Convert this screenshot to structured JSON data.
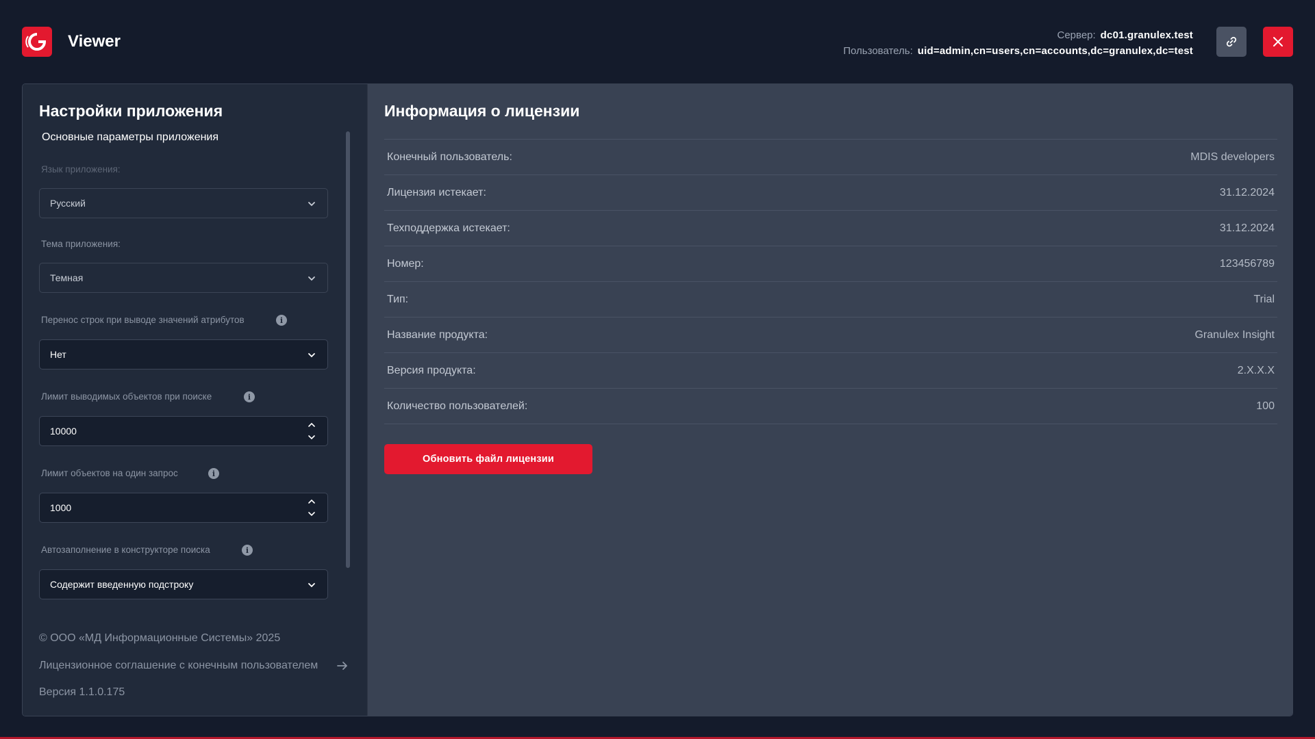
{
  "header": {
    "app_title": "Viewer",
    "server_label": "Сервер:",
    "server_value": "dc01.granulex.test",
    "user_label": "Пользователь:",
    "user_value": "uid=admin,cn=users,cn=accounts,dc=granulex,dc=test",
    "link_icon": "link-icon",
    "close_icon": "close-icon"
  },
  "settings": {
    "title": "Настройки приложения",
    "section": "Основные параметры приложения",
    "language_label": "Язык приложения:",
    "language_value": "Русский",
    "theme_label": "Тема приложения:",
    "theme_value": "Темная",
    "wrap_label": "Перенос строк при выводе значений атрибутов",
    "wrap_value": "Нет",
    "search_limit_label": "Лимит выводимых объектов при поиске",
    "search_limit_value": "10000",
    "request_limit_label": "Лимит объектов на один запрос",
    "request_limit_value": "1000",
    "autocomplete_label": "Автозаполнение в конструкторе поиска",
    "autocomplete_value": "Содержит введенную подстроку"
  },
  "footer": {
    "copyright": "© ООО «МД Информационные Системы» 2025",
    "eula_link": "Лицензионное соглашение с конечным пользователем",
    "version": "Версия 1.1.0.175"
  },
  "license": {
    "title": "Информация о лицензии",
    "rows": [
      {
        "key": "Конечный пользователь:",
        "value": "MDIS developers"
      },
      {
        "key": "Лицензия истекает:",
        "value": "31.12.2024"
      },
      {
        "key": "Техподдержка истекает:",
        "value": "31.12.2024"
      },
      {
        "key": "Номер:",
        "value": "123456789"
      },
      {
        "key": "Тип:",
        "value": "Trial"
      },
      {
        "key": "Название продукта:",
        "value": "Granulex Insight"
      },
      {
        "key": "Версия продукта:",
        "value": "2.X.X.X"
      },
      {
        "key": "Количество пользователей:",
        "value": "100"
      }
    ],
    "update_button": "Обновить файл лицензии"
  },
  "colors": {
    "accent": "#e3192f",
    "background": "#141b2b",
    "left_panel": "#212a3a",
    "right_panel": "#394253"
  }
}
